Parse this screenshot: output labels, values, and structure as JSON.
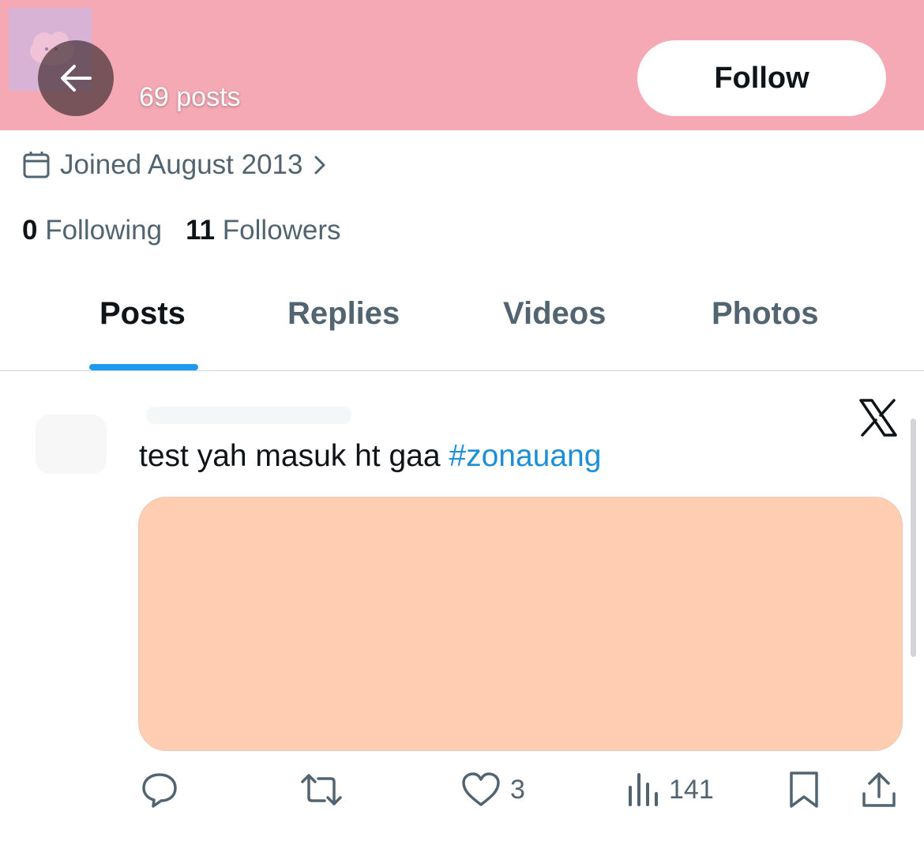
{
  "header": {
    "posts_count": "69 posts",
    "follow_label": "Follow",
    "banner_color": "#f4a9b4"
  },
  "profile": {
    "joined": "Joined August 2013",
    "following_count": "0",
    "following_label": "Following",
    "followers_count": "11",
    "followers_label": "Followers"
  },
  "tabs": [
    {
      "label": "Posts",
      "active": true
    },
    {
      "label": "Replies",
      "active": false
    },
    {
      "label": "Videos",
      "active": false
    },
    {
      "label": "Photos",
      "active": false
    }
  ],
  "post": {
    "text": "test yah masuk ht gaa ",
    "hashtag": "#zonauang",
    "source_icon": "x-logo-icon",
    "media_color": "#fecdb2",
    "actions": {
      "reply_icon": "reply-icon",
      "repost_icon": "repost-icon",
      "like_icon": "heart-icon",
      "likes": "3",
      "views_icon": "views-chart-icon",
      "views": "141",
      "bookmark_icon": "bookmark-icon",
      "share_icon": "share-icon"
    }
  },
  "colors": {
    "accent": "#1d9bf0",
    "hashtag": "#1d8fd6",
    "secondary_text": "#536471"
  }
}
